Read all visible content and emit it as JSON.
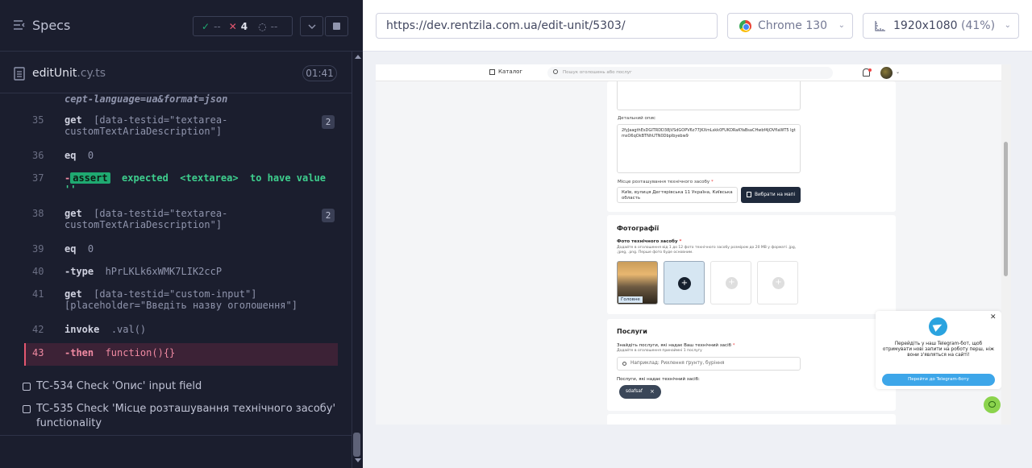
{
  "left": {
    "header": {
      "title": "Specs"
    },
    "stats": {
      "passed": "--",
      "failed": "4",
      "pending": "--"
    },
    "file": {
      "name": "editUnit",
      "ext": ".cy.ts",
      "duration": "01:41"
    },
    "commands": [
      {
        "num": "",
        "name": "",
        "msg": "cept-language=ua&format=json"
      },
      {
        "num": "35",
        "name": "get",
        "msg": "[data-testid=\"textarea-",
        "msg2": "customTextAriaDescription\"]",
        "badge": "2"
      },
      {
        "num": "36",
        "name": "eq",
        "msg": "0"
      },
      {
        "num": "37",
        "name": "-assert",
        "msg": "expected",
        "el": "<textarea>",
        "tail": "to have value",
        "tail2": "''"
      },
      {
        "num": "38",
        "name": "get",
        "msg": "[data-testid=\"textarea-",
        "msg2": "customTextAriaDescription\"]",
        "badge": "2"
      },
      {
        "num": "39",
        "name": "eq",
        "msg": "0"
      },
      {
        "num": "40",
        "name": "-type",
        "msg": "hPrLKLk6xWMK7LIK2ccP"
      },
      {
        "num": "41",
        "name": "get",
        "msg": "[data-testid=\"custom-input\"]",
        "msg2": "[placeholder=\"Введіть назву оголошення\"]"
      },
      {
        "num": "42",
        "name": "invoke",
        "msg": ".val()"
      },
      {
        "num": "43",
        "name": "-then",
        "msg": "function(){}"
      }
    ],
    "tests": [
      {
        "label": "TC-534 Check 'Опис' input field"
      },
      {
        "label": "TC-535 Check 'Місце розташування технічного засобу' functionality"
      }
    ]
  },
  "right": {
    "url": "https://dev.rentzila.com.ua/edit-unit/5303/",
    "browser": "Chrome 130",
    "viewport": "1920x1080",
    "zoom": "(41%)",
    "app": {
      "nav": {
        "catalog": "Каталог",
        "search_placeholder": "Пошук оголошень або послуг"
      },
      "desc": {
        "label": "Детальний опис",
        "value": "2fyJaagthEsDGITRDD38jVSdGOPV6z77JKXmLskk0FUKDRaKYaBsaCHwbf4jOVfIaWT5 lgtmsO6qOkBTNhUTN0Dbplbyebw9"
      },
      "location": {
        "label": "Місце розташування технічного засобу",
        "value": "Київ, вулиця Дегтярівська 11 Україна, Київська область",
        "button": "Вибрати на мапі"
      },
      "photos": {
        "title": "Фотографії",
        "label": "Фото технічного засобу",
        "hint": "Додайте в оголошення від 1 до 12 фото технічного засобу розміром до 20 МВ у форматі .jpg, .jpeg, .png. Перше фото буде основним.",
        "main_tag": "Головне"
      },
      "services": {
        "title": "Послуги",
        "label": "Знайдіть послуги, які надає Ваш технічний засіб",
        "hint": "Додайте в оголошення принаймні 1 послугу",
        "search_placeholder": "Наприклад: Рихлення ґрунту, буріння",
        "chosen_label": "Послуги, які надає технічний засіб:",
        "chip": "sdafsaf"
      },
      "telegram": {
        "text": "Перейдіть у наш Telegram-бот, щоб отримувати нові запити на роботу перш, ніж вони з'являться на сайті!",
        "button": "Перейти до Telegram-боту"
      }
    }
  }
}
